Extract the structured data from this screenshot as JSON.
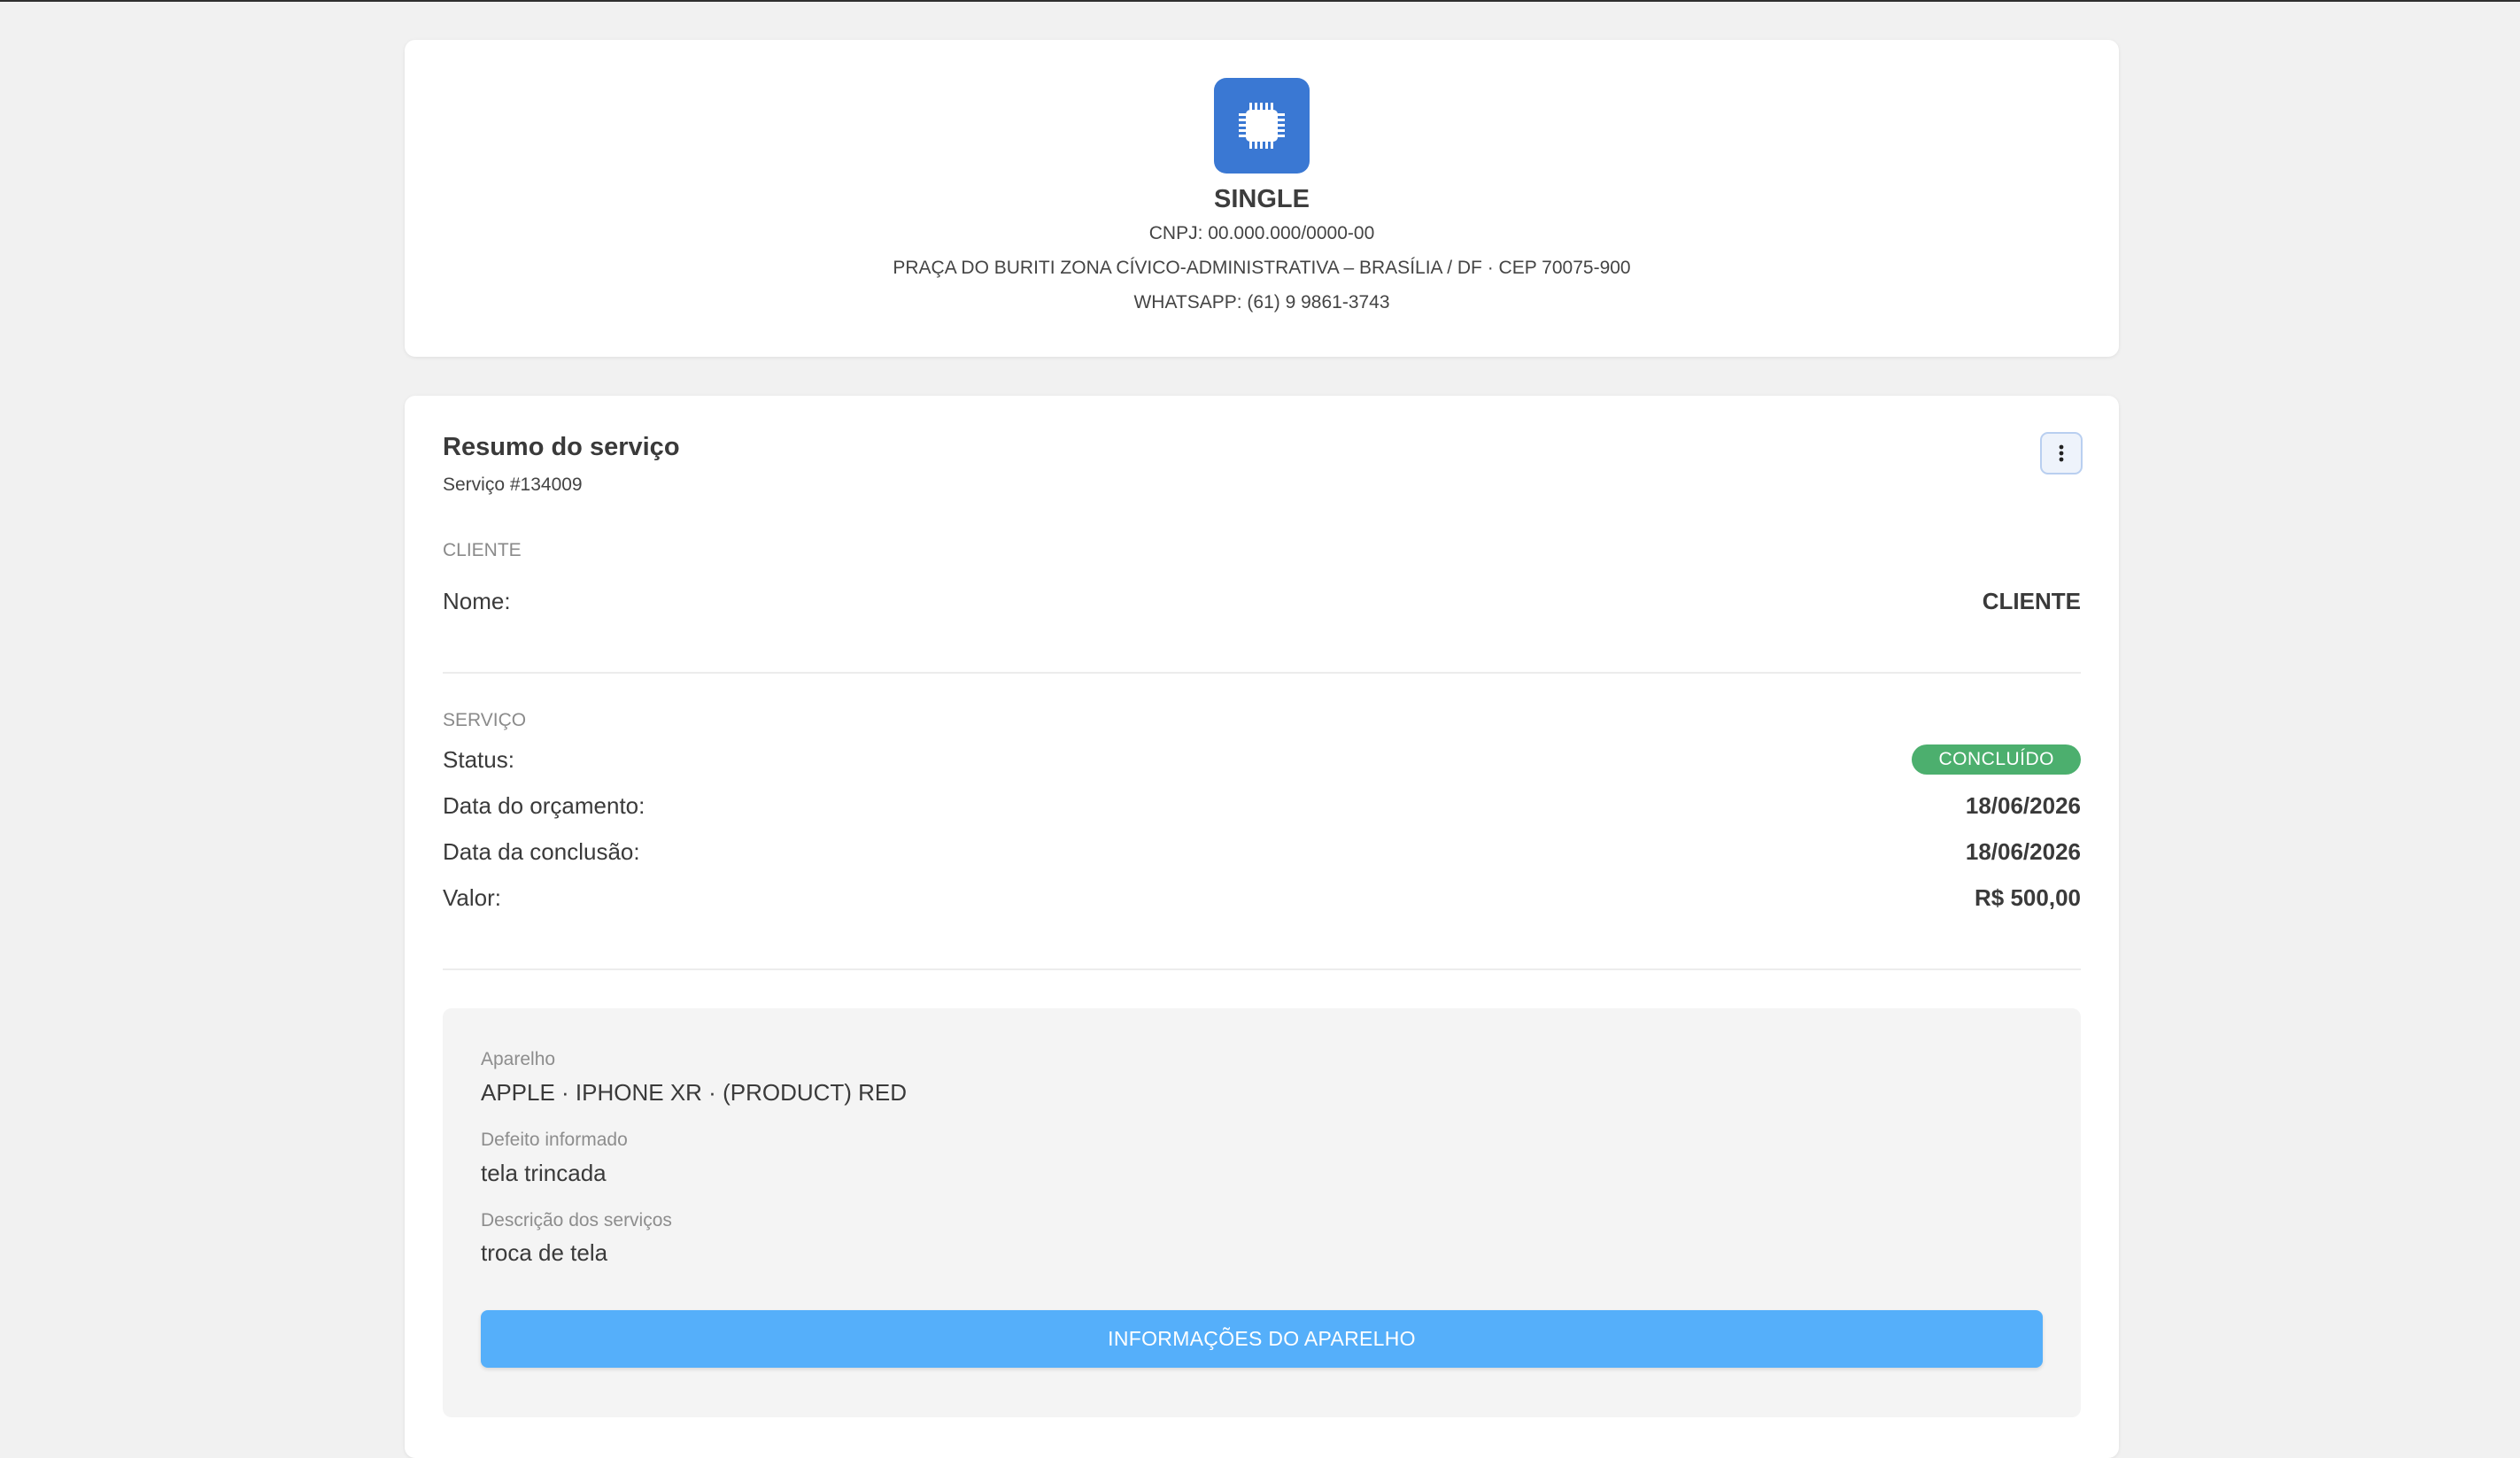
{
  "company": {
    "name": "SINGLE",
    "cnpj": "CNPJ: 00.000.000/0000-00",
    "address": "PRAÇA DO BURITI ZONA CÍVICO-ADMINISTRATIVA – BRASÍLIA / DF · CEP 70075-900",
    "whatsapp": "WHATSAPP: (61) 9 9861-3743",
    "logo_icon": "chip-icon",
    "logo_color": "#3a78d3"
  },
  "summary": {
    "title": "Resumo do serviço",
    "service_number": "Serviço #134009",
    "menu_icon": "more-vertical-icon"
  },
  "client": {
    "section_label": "CLIENTE",
    "name_label": "Nome:",
    "name_value": "CLIENTE"
  },
  "service": {
    "section_label": "SERVIÇO",
    "status_label": "Status:",
    "status_value": "CONCLUÍDO",
    "status_color": "#4caf6e",
    "budget_date_label": "Data do orçamento:",
    "budget_date_value": "18/06/2026",
    "completion_date_label": "Data da conclusão:",
    "completion_date_value": "18/06/2026",
    "value_label": "Valor:",
    "value_value": "R$ 500,00"
  },
  "device": {
    "device_label": "Aparelho",
    "device_value": "APPLE · IPHONE XR · (PRODUCT) RED",
    "defect_label": "Defeito informado",
    "defect_value": "tela trincada",
    "services_label": "Descrição dos serviços",
    "services_value": "troca de tela",
    "button_label": "INFORMAÇÕES DO APARELHO",
    "button_color": "#55affa"
  }
}
